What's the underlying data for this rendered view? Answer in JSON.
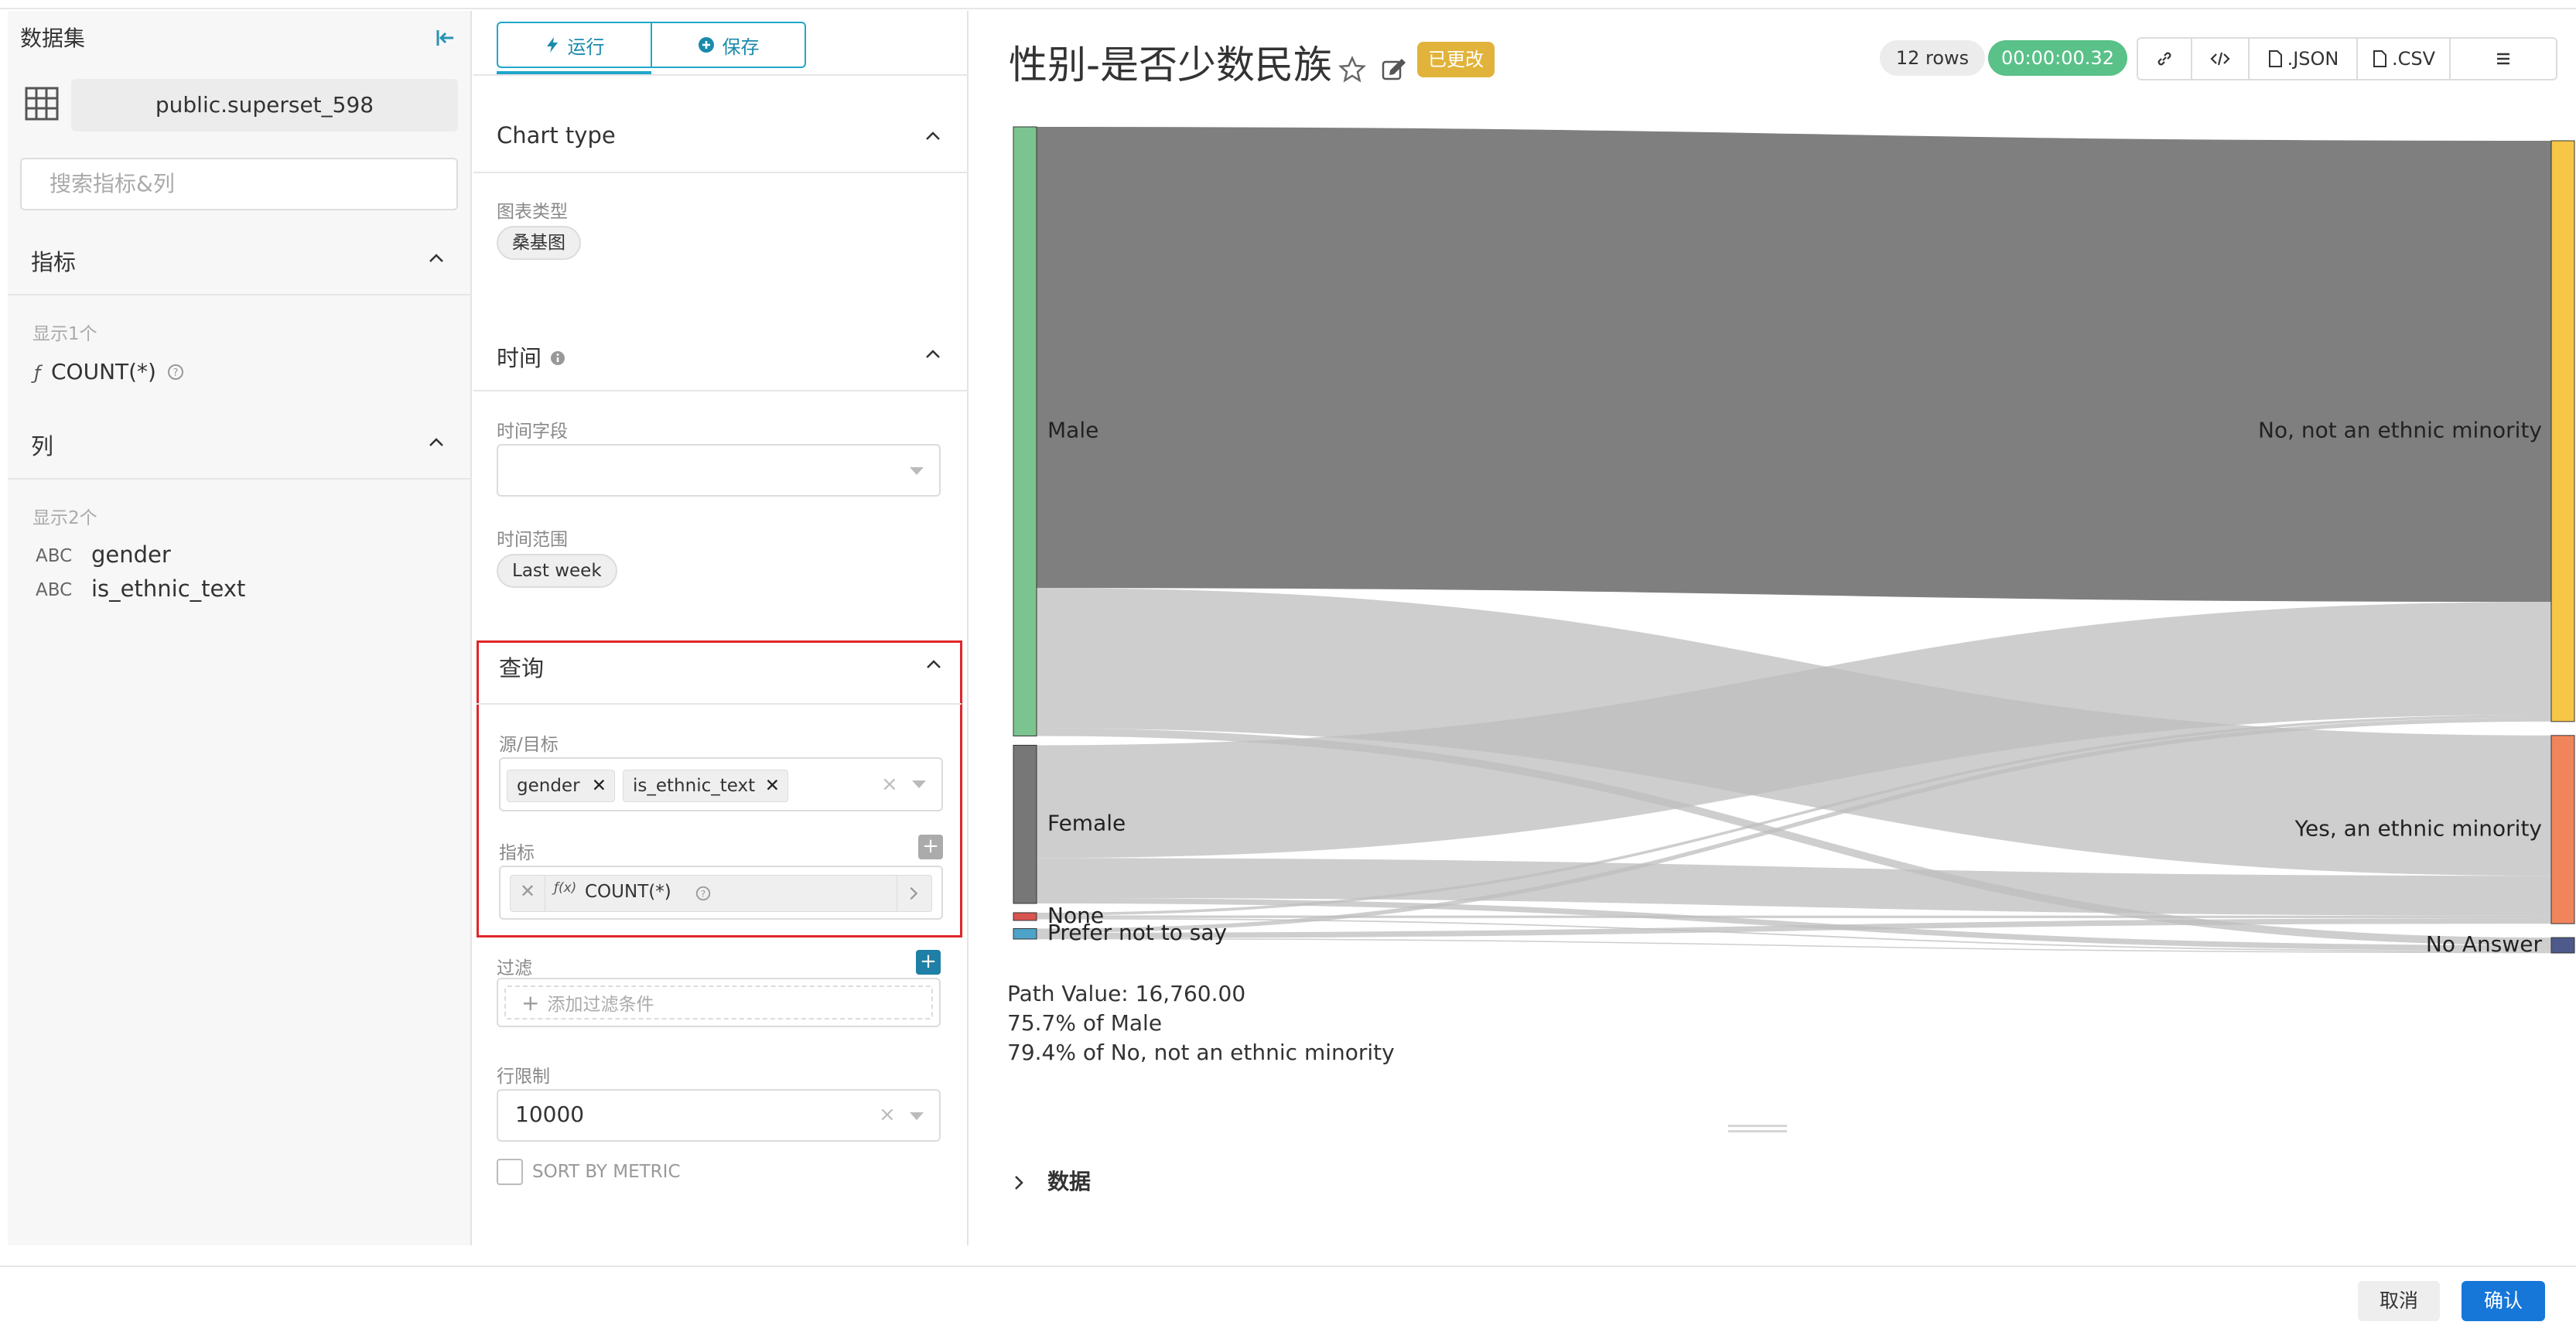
{
  "dataset": {
    "header": "数据集",
    "name": "public.superset_598",
    "search_placeholder": "搜索指标&列",
    "metrics_title": "指标",
    "metrics_count": "显示1个",
    "metrics": [
      {
        "type": "ƒ",
        "name": "COUNT(*)"
      }
    ],
    "columns_title": "列",
    "columns_count": "显示2个",
    "columns": [
      {
        "type": "ABC",
        "name": "gender"
      },
      {
        "type": "ABC",
        "name": "is_ethnic_text"
      }
    ]
  },
  "controls": {
    "run_label": "运行",
    "save_label": "保存",
    "chart_type_title": "Chart type",
    "chart_type_label": "图表类型",
    "chart_type_value": "桑基图",
    "time_title": "时间",
    "time_field_label": "时间字段",
    "time_range_label": "时间范围",
    "time_range_value": "Last week",
    "query_title": "查询",
    "source_target_label": "源/目标",
    "source_target_tags": [
      "gender",
      "is_ethnic_text"
    ],
    "metric_label": "指标",
    "metric_value": "COUNT(*)",
    "metric_fx": "ƒ(x)",
    "filter_label": "过滤",
    "filter_add": "添加过滤条件",
    "row_limit_label": "行限制",
    "row_limit_value": "10000",
    "sort_by_metric": "SORT BY METRIC"
  },
  "chart": {
    "title": "性别-是否少数民族",
    "altered_badge": "已更改",
    "rows_badge": "12 rows",
    "time_badge": "00:00:00.32",
    "toolbar": {
      "json": ".JSON",
      "csv": ".CSV"
    },
    "tooltip": {
      "line1": "Path Value: 16,760.00",
      "line2": "75.7% of Male",
      "line3": "79.4% of No, not an ethnic minority"
    },
    "data_toggle": "数据"
  },
  "chart_data": {
    "type": "sankey",
    "nodes": [
      {
        "name": "Male",
        "side": "source",
        "value": 22140,
        "color": "#7cc48f"
      },
      {
        "name": "Female",
        "side": "source",
        "value": 5750,
        "color": "#777777"
      },
      {
        "name": "None",
        "side": "source",
        "value": 240,
        "color": "#d9534f"
      },
      {
        "name": "Prefer not to say",
        "side": "source",
        "value": 380,
        "color": "#4ea3c9"
      },
      {
        "name": "No, not an ethnic minority",
        "side": "target",
        "value": 21110,
        "color": "#f6c646"
      },
      {
        "name": "Yes, an ethnic minority",
        "side": "target",
        "value": 6840,
        "color": "#f0855c"
      },
      {
        "name": "No Answer",
        "side": "target",
        "value": 560,
        "color": "#4d5a8a"
      }
    ],
    "links": [
      {
        "source": "Male",
        "target": "No, not an ethnic minority",
        "value": 16760,
        "highlight": true
      },
      {
        "source": "Male",
        "target": "Yes, an ethnic minority",
        "value": 5100
      },
      {
        "source": "Male",
        "target": "No Answer",
        "value": 280
      },
      {
        "source": "Female",
        "target": "No, not an ethnic minority",
        "value": 4100
      },
      {
        "source": "Female",
        "target": "Yes, an ethnic minority",
        "value": 1450
      },
      {
        "source": "Female",
        "target": "No Answer",
        "value": 200
      },
      {
        "source": "None",
        "target": "No, not an ethnic minority",
        "value": 100
      },
      {
        "source": "None",
        "target": "Yes, an ethnic minority",
        "value": 90
      },
      {
        "source": "None",
        "target": "No Answer",
        "value": 50
      },
      {
        "source": "Prefer not to say",
        "target": "No, not an ethnic minority",
        "value": 150
      },
      {
        "source": "Prefer not to say",
        "target": "Yes, an ethnic minority",
        "value": 200
      },
      {
        "source": "Prefer not to say",
        "target": "No Answer",
        "value": 30
      }
    ]
  },
  "footer": {
    "cancel": "取消",
    "ok": "确认"
  }
}
